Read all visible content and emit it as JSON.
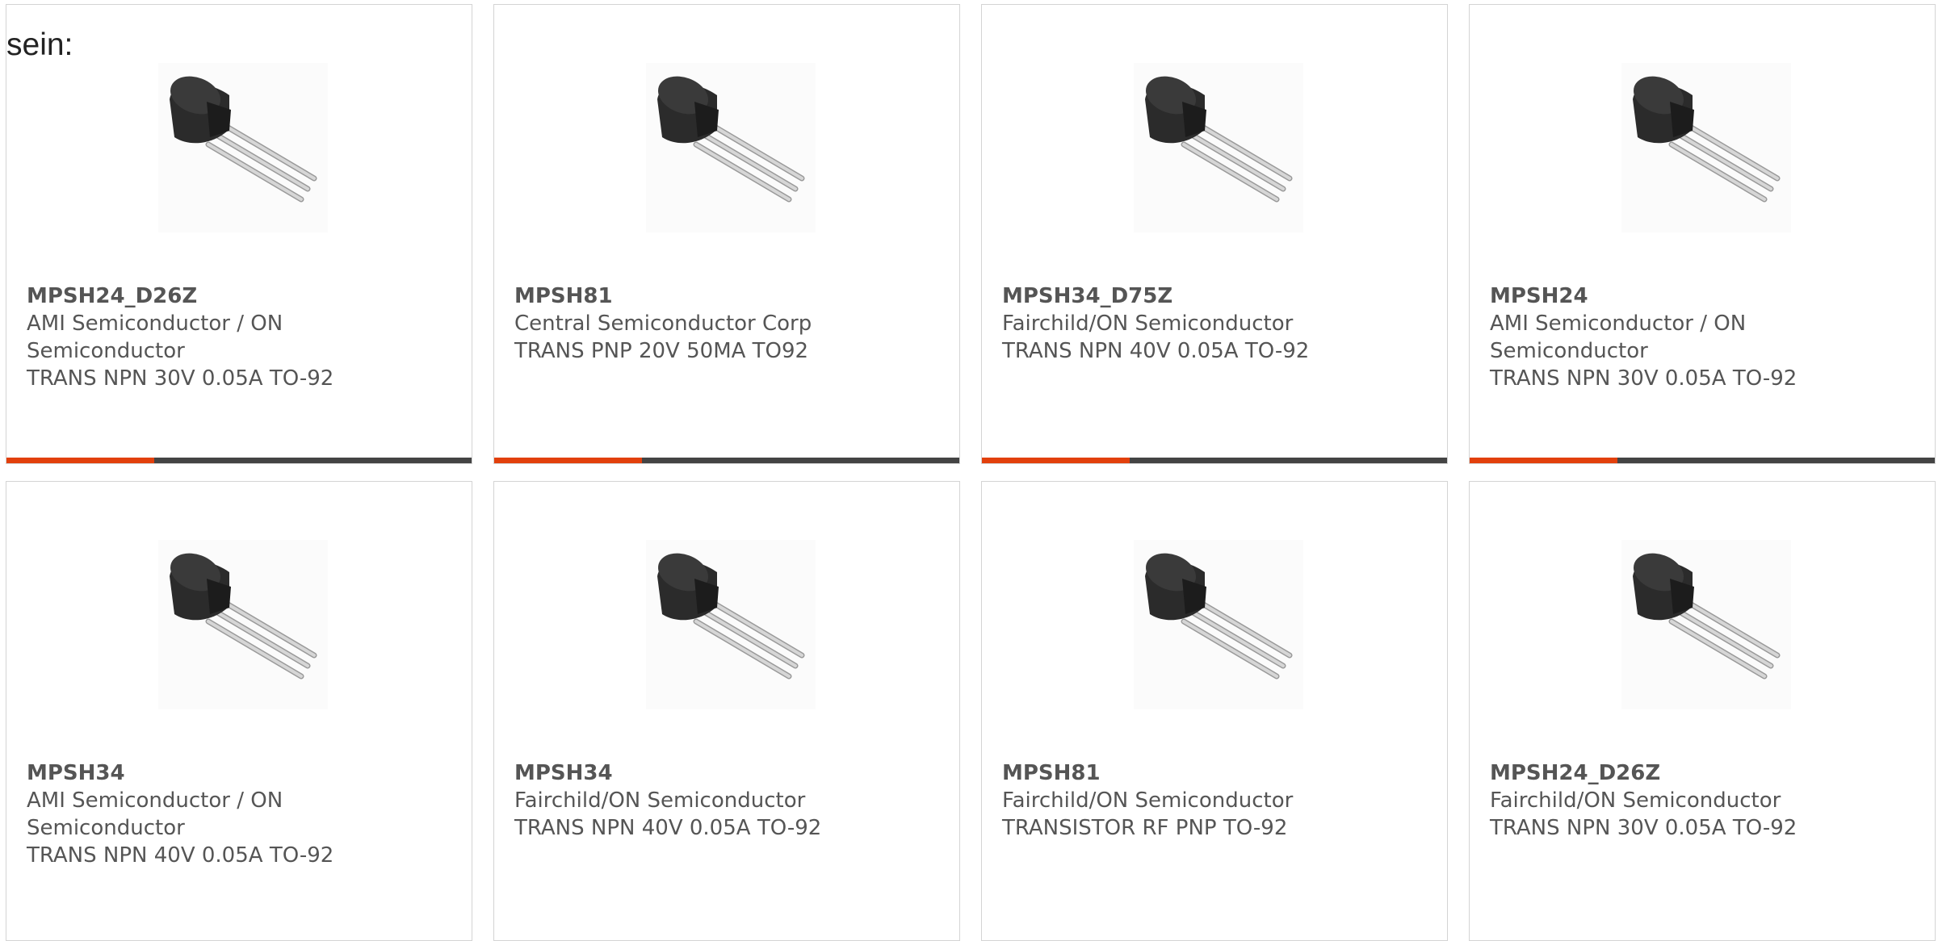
{
  "intro_text": "sein:",
  "colors": {
    "accent": "#e2400c",
    "bar_dark": "#444444",
    "text": "#555555",
    "border": "#d4d4d4"
  },
  "product_image_icon": "to92-transistor-icon",
  "products": [
    {
      "part": "MPSH24_D26Z",
      "manufacturer": "AMI Semiconductor / ON Semiconductor",
      "description": "TRANS NPN 30V 0.05A TO-92"
    },
    {
      "part": "MPSH81",
      "manufacturer": "Central Semiconductor Corp",
      "description": "TRANS PNP 20V 50MA TO92"
    },
    {
      "part": "MPSH34_D75Z",
      "manufacturer": "Fairchild/ON Semiconductor",
      "description": "TRANS NPN 40V 0.05A TO-92"
    },
    {
      "part": "MPSH24",
      "manufacturer": "AMI Semiconductor / ON Semiconductor",
      "description": "TRANS NPN 30V 0.05A TO-92"
    },
    {
      "part": "MPSH34",
      "manufacturer": "AMI Semiconductor / ON Semiconductor",
      "description": "TRANS NPN 40V 0.05A TO-92"
    },
    {
      "part": "MPSH34",
      "manufacturer": "Fairchild/ON Semiconductor",
      "description": "TRANS NPN 40V 0.05A TO-92"
    },
    {
      "part": "MPSH81",
      "manufacturer": "Fairchild/ON Semiconductor",
      "description": "TRANSISTOR RF PNP TO-92"
    },
    {
      "part": "MPSH24_D26Z",
      "manufacturer": "Fairchild/ON Semiconductor",
      "description": "TRANS NPN 30V 0.05A TO-92"
    }
  ]
}
